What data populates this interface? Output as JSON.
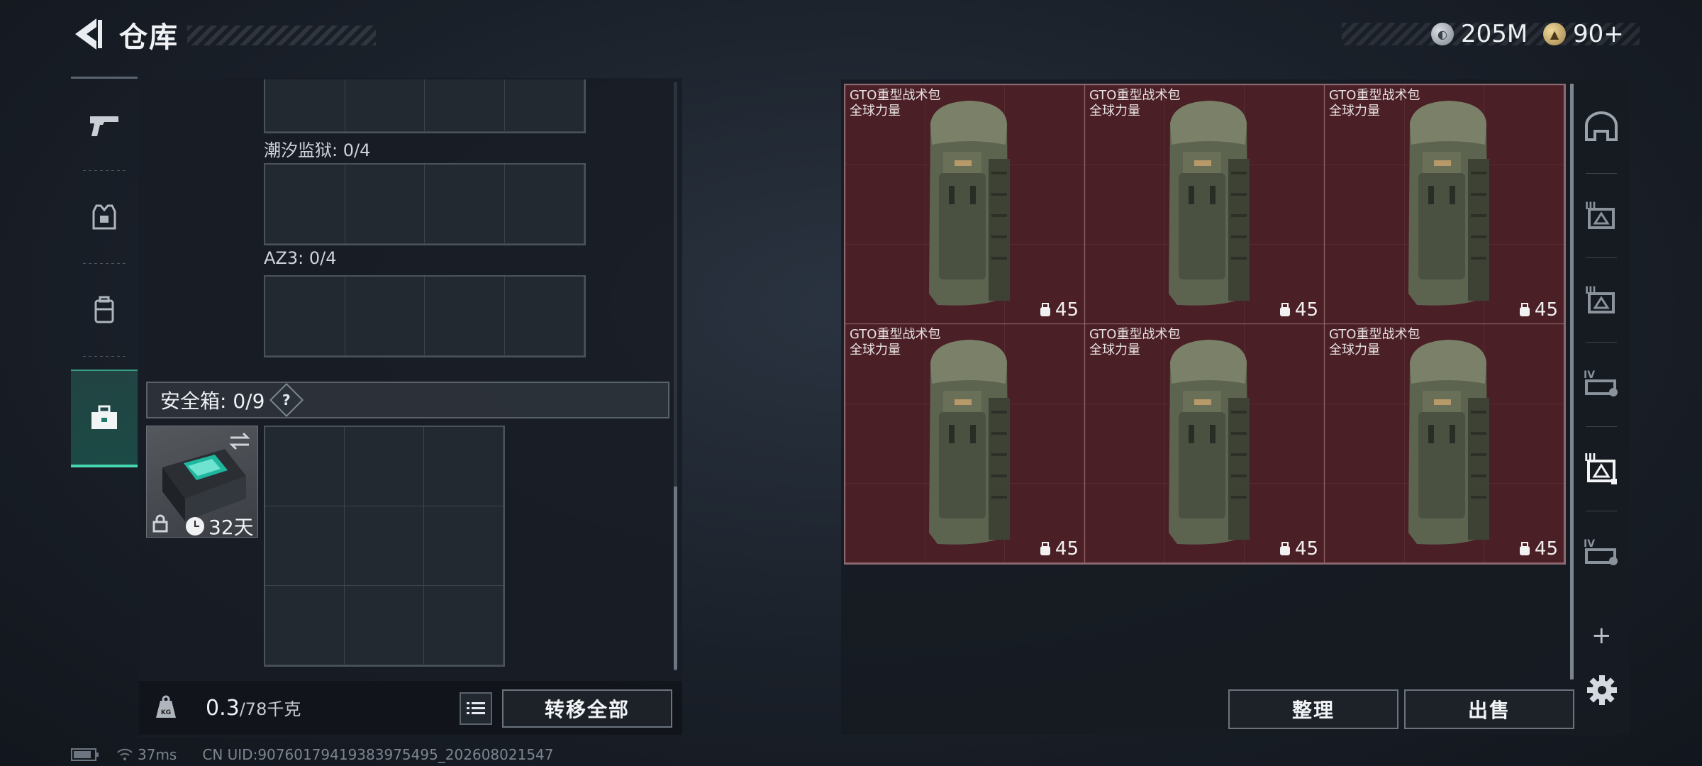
{
  "header": {
    "title": "仓库",
    "silver": "205M",
    "gold": "90+"
  },
  "left": {
    "sections": [
      {
        "label": "潮汐监狱: 0/4"
      },
      {
        "label": "AZ3: 0/4"
      }
    ],
    "safebox": {
      "label": "安全箱:  0/9",
      "help": "?",
      "days": "32天"
    },
    "weight": {
      "value": "0.3",
      "max": "/78千克"
    },
    "transfer_all": "转移全部"
  },
  "right": {
    "items": [
      {
        "name1": "GTO重型战术包",
        "name2": "全球力量",
        "count": "45"
      },
      {
        "name1": "GTO重型战术包",
        "name2": "全球力量",
        "count": "45"
      },
      {
        "name1": "GTO重型战术包",
        "name2": "全球力量",
        "count": "45"
      },
      {
        "name1": "GTO重型战术包",
        "name2": "全球力量",
        "count": "45"
      },
      {
        "name1": "GTO重型战术包",
        "name2": "全球力量",
        "count": "45"
      },
      {
        "name1": "GTO重型战术包",
        "name2": "全球力量",
        "count": "45"
      }
    ],
    "sort": "整理",
    "sell": "出售",
    "side_tabs": [
      "helmet-tier-icon",
      "armor-III-icon",
      "armor-III-icon",
      "backpack-IV-icon",
      "armor-III-active-icon",
      "backpack-IV-icon"
    ]
  },
  "status": {
    "ping": "37ms",
    "uid": "CN UID:90760179419383975495_202608021547"
  },
  "colors": {
    "accent": "#46d6b0",
    "item_bg": "#4b1f26"
  }
}
